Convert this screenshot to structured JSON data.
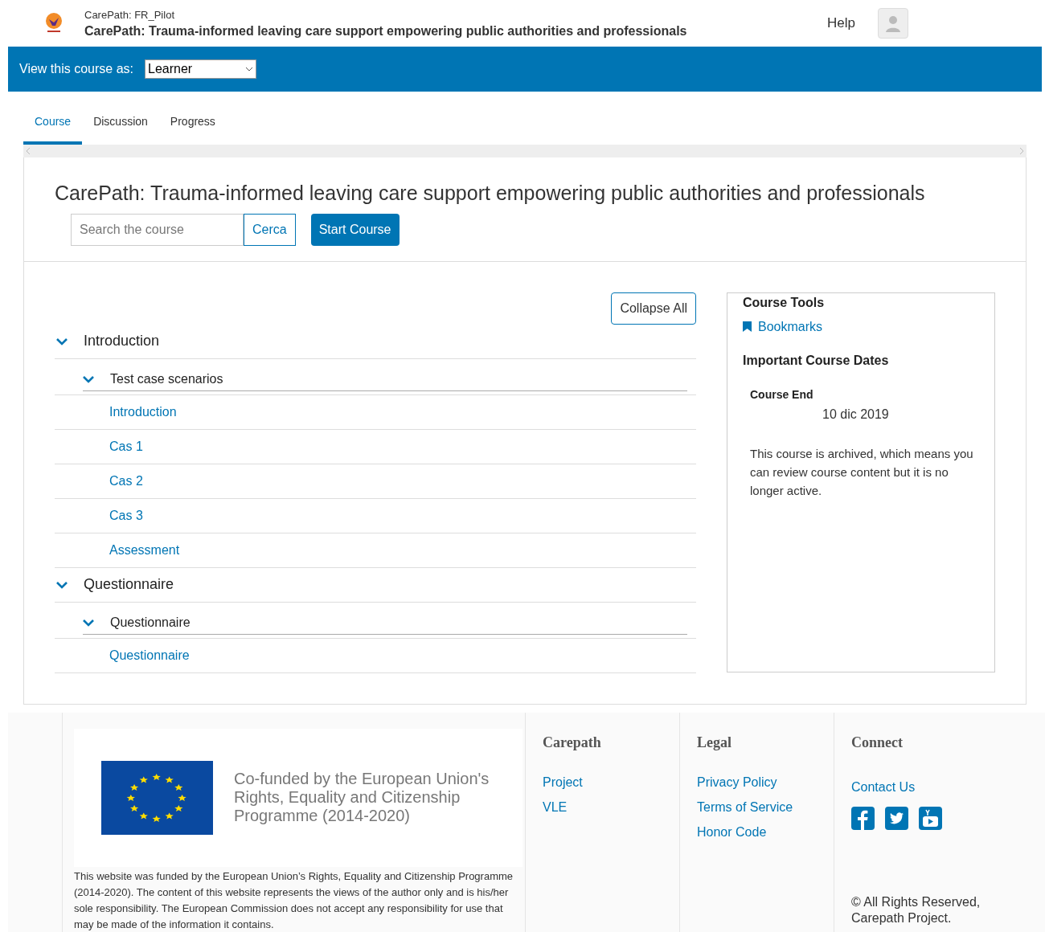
{
  "header": {
    "org": "CarePath: FR_Pilot",
    "title": "CarePath: Trauma-informed leaving care support empowering public authorities and professionals",
    "help": "Help"
  },
  "view_as": {
    "label": "View this course as:",
    "value": "Learner"
  },
  "tabs": [
    {
      "label": "Course",
      "selected": true
    },
    {
      "label": "Discussion",
      "selected": false
    },
    {
      "label": "Progress",
      "selected": false
    }
  ],
  "course": {
    "title": "CarePath: Trauma-informed leaving care support empowering public authorities and professionals",
    "search_placeholder": "Search the course",
    "search_button": "Cerca",
    "start_button": "Start Course",
    "collapse_button": "Collapse All"
  },
  "outline": [
    {
      "title": "Introduction",
      "expanded": true,
      "children": [
        {
          "title": "Test case scenarios",
          "expanded": true,
          "children": [
            {
              "title": "Introduction"
            },
            {
              "title": "Cas 1"
            },
            {
              "title": "Cas 2"
            },
            {
              "title": "Cas 3"
            },
            {
              "title": "Assessment"
            }
          ]
        }
      ]
    },
    {
      "title": "Questionnaire",
      "expanded": true,
      "children": [
        {
          "title": "Questionnaire",
          "expanded": true,
          "children": [
            {
              "title": "Questionnaire"
            }
          ]
        }
      ]
    }
  ],
  "sidebar": {
    "tools_title": "Course Tools",
    "bookmarks": "Bookmarks",
    "dates_title": "Important Course Dates",
    "date_label": "Course End",
    "date_value": "10 dic 2019",
    "date_note": "This course is archived, which means you can review course content but it is no longer active."
  },
  "footer": {
    "logo_text": "Co-funded by the European Union's Rights, Equality and Citizenship Programme (2014-2020)",
    "disclaimer": "This website was funded by the European Union’s Rights, Equality and Citizenship Programme (2014-2020). The content of this website represents the views of the author only and is his/her sole responsibility. The European Commission does not accept any responsibility for use that may be made of the information it contains.",
    "columns": [
      {
        "title": "Carepath",
        "links": [
          "Project",
          "VLE"
        ]
      },
      {
        "title": "Legal",
        "links": [
          "Privacy Policy",
          "Terms of Service",
          "Honor Code"
        ]
      },
      {
        "title": "Connect",
        "links": [
          "Contact Us"
        ]
      }
    ],
    "copyright": "© All Rights Reserved, Carepath Project."
  }
}
